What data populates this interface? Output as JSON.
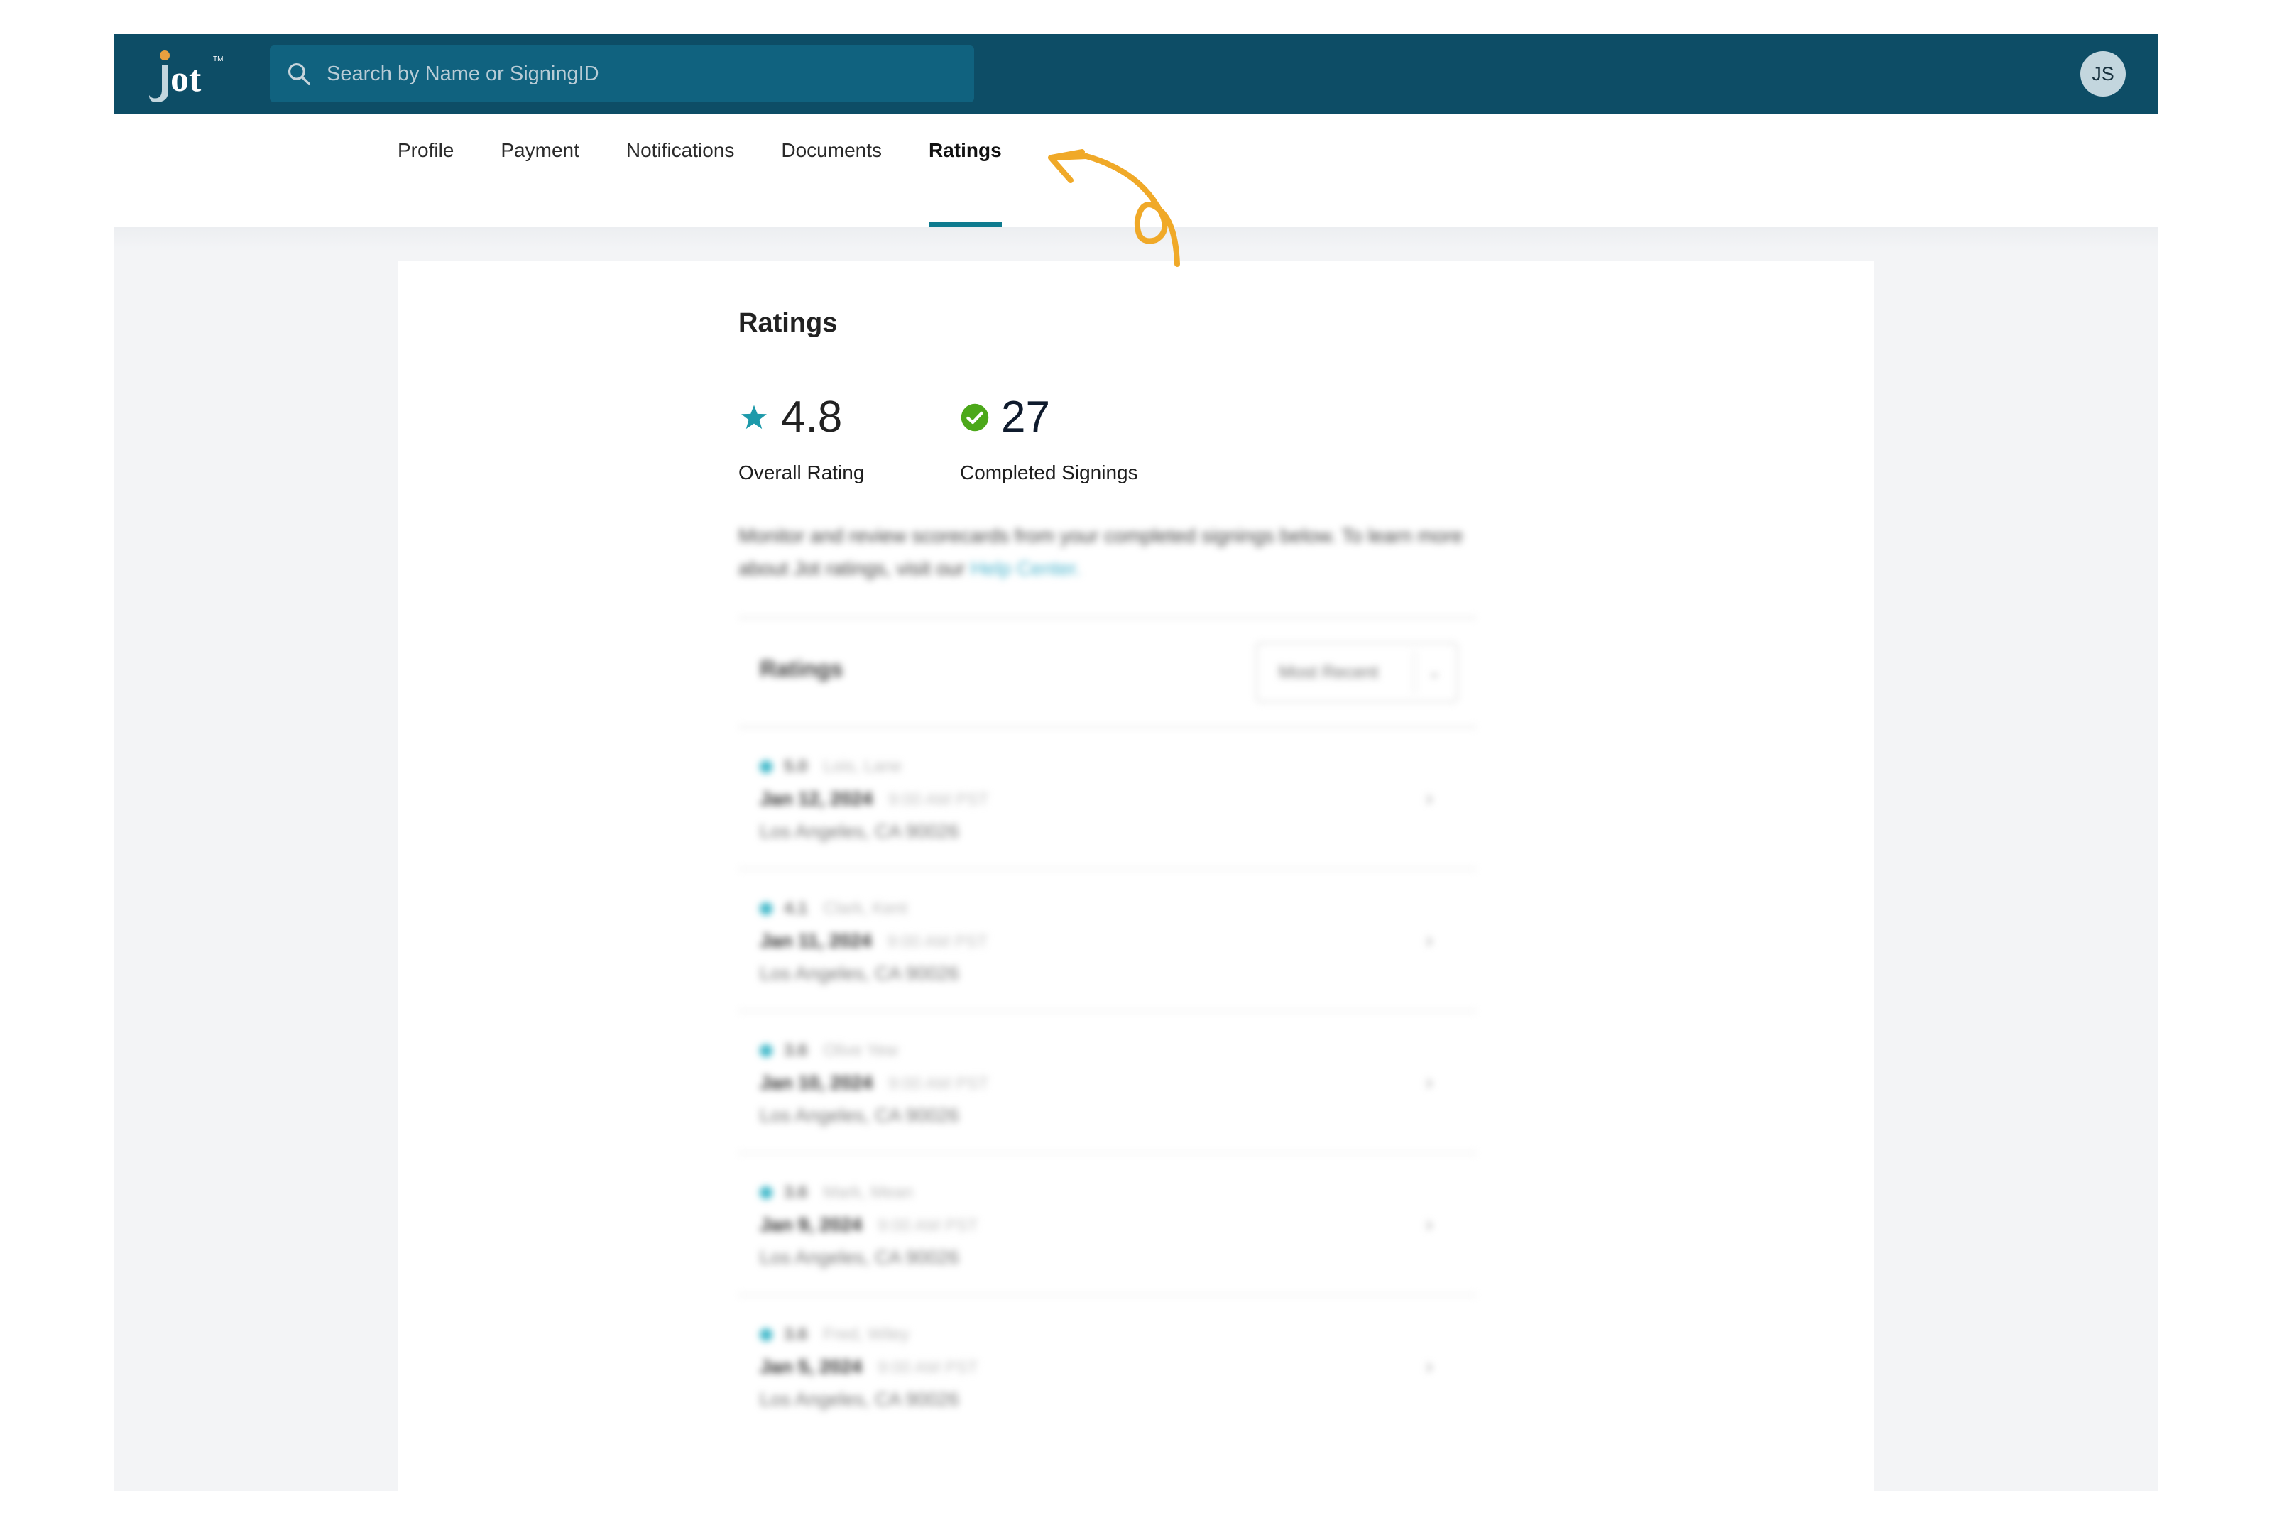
{
  "header": {
    "logo_text": "jot",
    "logo_mark": "TM",
    "search": {
      "placeholder": "Search by Name or SigningID",
      "value": "",
      "icon": "search-icon"
    },
    "avatar_initials": "JS"
  },
  "tabs": [
    {
      "label": "Profile",
      "active": false
    },
    {
      "label": "Payment",
      "active": false
    },
    {
      "label": "Notifications",
      "active": false
    },
    {
      "label": "Documents",
      "active": false
    },
    {
      "label": "Ratings",
      "active": true
    }
  ],
  "ratings": {
    "title": "Ratings",
    "overall_rating": {
      "value": "4.8",
      "label": "Overall Rating",
      "icon": "star-icon"
    },
    "completed_signings": {
      "value": "27",
      "label": "Completed Signings",
      "icon": "check-circle-icon"
    },
    "description": "Monitor and review scorecards from your completed signings below. To learn more about Jot ratings, visit our",
    "help_link": "Help Center.",
    "list": {
      "title": "Ratings",
      "sort": {
        "selected": "Most Recent"
      },
      "items": [
        {
          "score": "5.0",
          "name": "Lois, Lane",
          "date": "Jan 12, 2024",
          "time": "9:00 AM PST",
          "location": "Los Angeles, CA 90026"
        },
        {
          "score": "4.1",
          "name": "Clark, Kent",
          "date": "Jan 11, 2024",
          "time": "9:00 AM PST",
          "location": "Los Angeles, CA 90026"
        },
        {
          "score": "3.6",
          "name": "Olive Yew",
          "date": "Jan 10, 2024",
          "time": "9:00 AM PST",
          "location": "Los Angeles, CA 90026"
        },
        {
          "score": "3.6",
          "name": "Mark, Mean",
          "date": "Jan 9, 2024",
          "time": "9:00 AM PST",
          "location": "Los Angeles, CA 90026"
        },
        {
          "score": "3.6",
          "name": "Fred, Wiley",
          "date": "Jan 5, 2024",
          "time": "9:00 AM PST",
          "location": "Los Angeles, CA 90026"
        }
      ]
    }
  },
  "colors": {
    "topbar": "#0d4d66",
    "search_bg": "#10627f",
    "tab_underline": "#0e7b8f",
    "star": "#1d9aaa",
    "check": "#4ca81a",
    "annotation_arrow": "#f0a928",
    "page_bg": "#f3f4f6"
  }
}
